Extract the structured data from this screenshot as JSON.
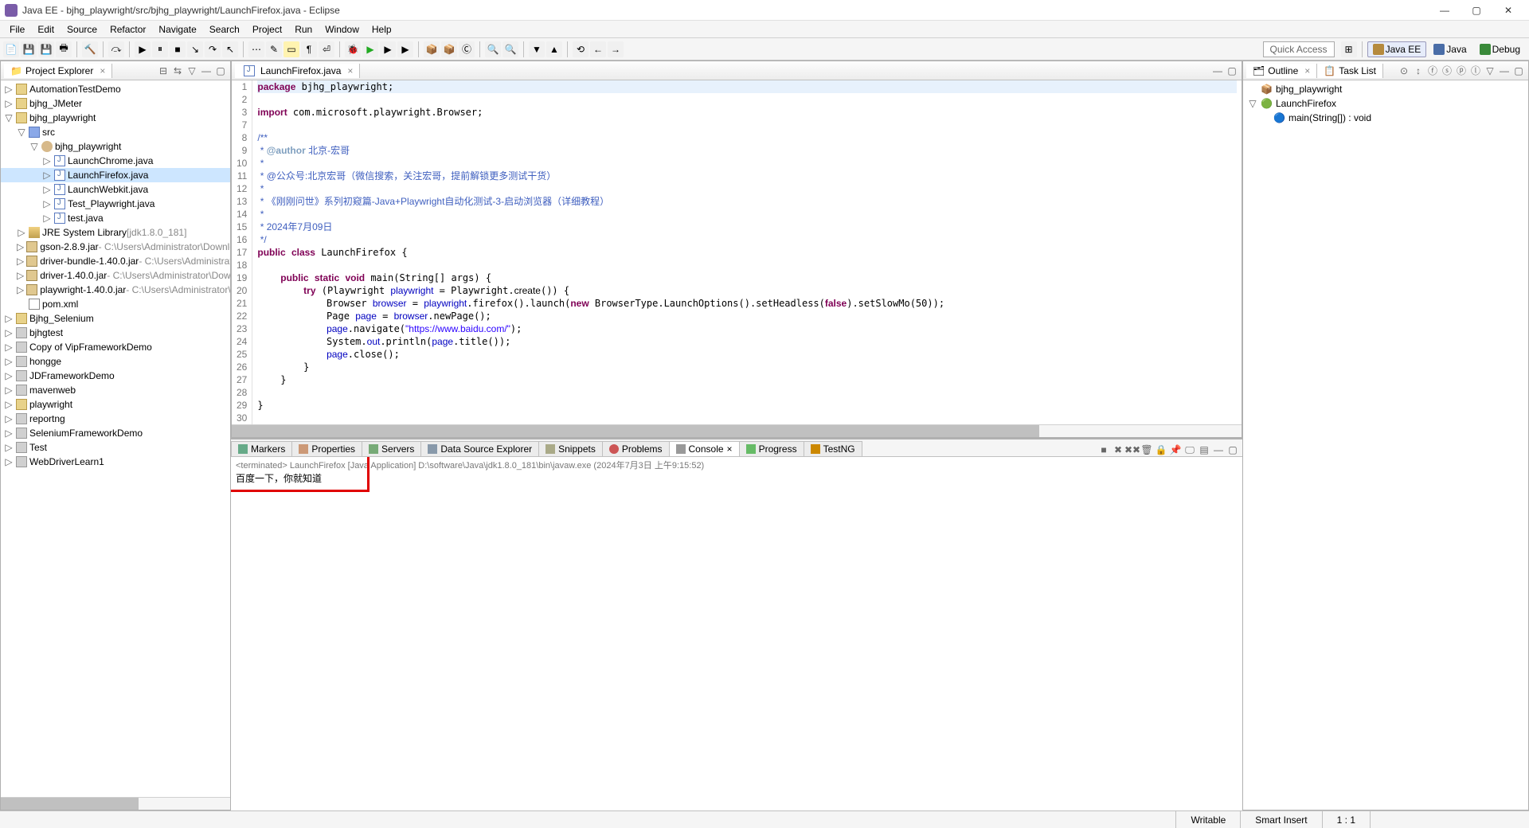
{
  "window": {
    "title": "Java EE - bjhg_playwright/src/bjhg_playwright/LaunchFirefox.java - Eclipse"
  },
  "menu": {
    "items": [
      "File",
      "Edit",
      "Source",
      "Refactor",
      "Navigate",
      "Search",
      "Project",
      "Run",
      "Window",
      "Help"
    ]
  },
  "toolbar": {
    "quick_access": "Quick Access",
    "perspectives": [
      {
        "name": "Java EE",
        "active": true
      },
      {
        "name": "Java",
        "active": false
      },
      {
        "name": "Debug",
        "active": false
      }
    ]
  },
  "project_explorer": {
    "title": "Project Explorer",
    "tree": [
      {
        "indent": 0,
        "tw": "▷",
        "icon": "proj",
        "label": "AutomationTestDemo"
      },
      {
        "indent": 0,
        "tw": "▷",
        "icon": "proj",
        "label": "bjhg_JMeter"
      },
      {
        "indent": 0,
        "tw": "▽",
        "icon": "proj",
        "label": "bjhg_playwright"
      },
      {
        "indent": 1,
        "tw": "▽",
        "icon": "folder",
        "label": "src"
      },
      {
        "indent": 2,
        "tw": "▽",
        "icon": "pkg",
        "label": "bjhg_playwright"
      },
      {
        "indent": 3,
        "tw": "▷",
        "icon": "java",
        "label": "LaunchChrome.java"
      },
      {
        "indent": 3,
        "tw": "▷",
        "icon": "java",
        "label": "LaunchFirefox.java",
        "selected": true
      },
      {
        "indent": 3,
        "tw": "▷",
        "icon": "java",
        "label": "LaunchWebkit.java"
      },
      {
        "indent": 3,
        "tw": "▷",
        "icon": "java",
        "label": "Test_Playwright.java"
      },
      {
        "indent": 3,
        "tw": "▷",
        "icon": "java",
        "label": "test.java"
      },
      {
        "indent": 1,
        "tw": "▷",
        "icon": "lib",
        "label": "JRE System Library",
        "suffix": "[jdk1.8.0_181]"
      },
      {
        "indent": 1,
        "tw": "▷",
        "icon": "jar",
        "label": "gson-2.8.9.jar",
        "suffix": "- C:\\Users\\Administrator\\Downloads"
      },
      {
        "indent": 1,
        "tw": "▷",
        "icon": "jar",
        "label": "driver-bundle-1.40.0.jar",
        "suffix": "- C:\\Users\\Administrator\\Do"
      },
      {
        "indent": 1,
        "tw": "▷",
        "icon": "jar",
        "label": "driver-1.40.0.jar",
        "suffix": "- C:\\Users\\Administrator\\Download"
      },
      {
        "indent": 1,
        "tw": "▷",
        "icon": "jar",
        "label": "playwright-1.40.0.jar",
        "suffix": "- C:\\Users\\Administrator\\Down"
      },
      {
        "indent": 1,
        "tw": "",
        "icon": "xml",
        "label": "pom.xml"
      },
      {
        "indent": 0,
        "tw": "▷",
        "icon": "proj",
        "label": "Bjhg_Selenium"
      },
      {
        "indent": 0,
        "tw": "▷",
        "icon": "projc",
        "label": "bjhgtest"
      },
      {
        "indent": 0,
        "tw": "▷",
        "icon": "projc",
        "label": "Copy of VipFrameworkDemo"
      },
      {
        "indent": 0,
        "tw": "▷",
        "icon": "projc",
        "label": "hongge"
      },
      {
        "indent": 0,
        "tw": "▷",
        "icon": "projc",
        "label": "JDFrameworkDemo"
      },
      {
        "indent": 0,
        "tw": "▷",
        "icon": "projc",
        "label": "mavenweb"
      },
      {
        "indent": 0,
        "tw": "▷",
        "icon": "proj",
        "label": "playwright"
      },
      {
        "indent": 0,
        "tw": "▷",
        "icon": "projc",
        "label": "reportng"
      },
      {
        "indent": 0,
        "tw": "▷",
        "icon": "projc",
        "label": "SeleniumFrameworkDemo"
      },
      {
        "indent": 0,
        "tw": "▷",
        "icon": "projc",
        "label": "Test"
      },
      {
        "indent": 0,
        "tw": "▷",
        "icon": "projc",
        "label": "WebDriverLearn1"
      }
    ]
  },
  "editor": {
    "filename": "LaunchFirefox.java",
    "line_numbers": [
      "1",
      "2",
      "3",
      "7",
      "8",
      "9",
      "10",
      "11",
      "12",
      "13",
      "14",
      "15",
      "16",
      "17",
      "18",
      "19",
      "20",
      "21",
      "22",
      "23",
      "24",
      "25",
      "26",
      "27",
      "28",
      "29",
      "30"
    ],
    "lines": [
      {
        "sel": true,
        "html": "<span class='kw'>package</span> bjhg_playwright;"
      },
      {
        "html": ""
      },
      {
        "html": "<span class='kw'>import</span> com.microsoft.playwright.Browser;"
      },
      {
        "html": ""
      },
      {
        "html": "<span class='cm'>/**</span>"
      },
      {
        "html": "<span class='cm'> * </span><span class='tag'>@author</span><span class='cm'> 北京-宏哥</span>"
      },
      {
        "html": "<span class='cm'> *</span>"
      },
      {
        "html": "<span class='cm'> * @公众号:北京宏哥（微信搜索，关注宏哥，提前解锁更多测试干货）</span>"
      },
      {
        "html": "<span class='cm'> *</span>"
      },
      {
        "html": "<span class='cm'> * 《刚刚问世》系列初窥篇-Java+Playwright自动化测试-3-启动浏览器（详细教程）</span>"
      },
      {
        "html": "<span class='cm'> *</span>"
      },
      {
        "html": "<span class='cm'> * 2024年7月09日</span>"
      },
      {
        "html": "<span class='cm'> */</span>"
      },
      {
        "html": "<span class='kw'>public</span> <span class='kw'>class</span> LaunchFirefox {"
      },
      {
        "html": ""
      },
      {
        "html": "    <span class='kw'>public</span> <span class='kw'>static</span> <span class='kw'>void</span> main(String[] args) {"
      },
      {
        "html": "        <span class='kw'>try</span> (Playwright <span class='fld'>playwright</span> = Playwright.<span class='typ'>create</span>()) {"
      },
      {
        "html": "            Browser <span class='fld'>browser</span> = <span class='fld'>playwright</span>.firefox().launch(<span class='kw'>new</span> BrowserType.LaunchOptions().setHeadless(<span class='kw'>false</span>).setSlowMo(50));"
      },
      {
        "html": "            Page <span class='fld'>page</span> = <span class='fld'>browser</span>.newPage();"
      },
      {
        "html": "            <span class='fld'>page</span>.navigate(<span class='str'>\"https://www.baidu.com/\"</span>);"
      },
      {
        "html": "            System.<span class='fld'>out</span>.println(<span class='fld'>page</span>.title());"
      },
      {
        "html": "            <span class='fld'>page</span>.close();"
      },
      {
        "html": "        }"
      },
      {
        "html": "    }"
      },
      {
        "html": ""
      },
      {
        "html": "}"
      },
      {
        "html": ""
      }
    ]
  },
  "bottom_tabs": [
    {
      "icon": "markers",
      "label": "Markers"
    },
    {
      "icon": "props",
      "label": "Properties"
    },
    {
      "icon": "servers",
      "label": "Servers"
    },
    {
      "icon": "dse",
      "label": "Data Source Explorer"
    },
    {
      "icon": "snip",
      "label": "Snippets"
    },
    {
      "icon": "problems",
      "label": "Problems"
    },
    {
      "icon": "console",
      "label": "Console",
      "active": true
    },
    {
      "icon": "progress",
      "label": "Progress"
    },
    {
      "icon": "testng",
      "label": "TestNG"
    }
  ],
  "console": {
    "info": "<terminated> LaunchFirefox [Java Application] D:\\software\\Java\\jdk1.8.0_181\\bin\\javaw.exe (2024年7月3日 上午9:15:52)",
    "output": "百度一下，你就知道"
  },
  "outline": {
    "tabs": [
      "Outline",
      "Task List"
    ],
    "items": [
      {
        "indent": 0,
        "tw": "",
        "icon": "pkg",
        "label": "bjhg_playwright"
      },
      {
        "indent": 0,
        "tw": "▽",
        "icon": "class",
        "label": "LaunchFirefox"
      },
      {
        "indent": 1,
        "tw": "",
        "icon": "method",
        "label": "main(String[]) : void"
      }
    ]
  },
  "status": {
    "writable": "Writable",
    "insert": "Smart Insert",
    "pos": "1 : 1"
  }
}
